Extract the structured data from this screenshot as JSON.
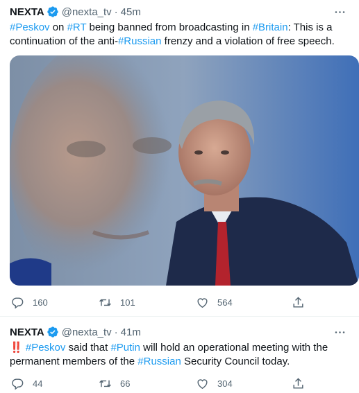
{
  "tweets": [
    {
      "name": "NEXTA",
      "handle": "@nexta_tv",
      "dot": "·",
      "time": "45m",
      "segments": [
        {
          "text": "#Peskov",
          "tag": true
        },
        {
          "text": " on ",
          "tag": false
        },
        {
          "text": "#RT",
          "tag": true
        },
        {
          "text": " being banned from broadcasting in ",
          "tag": false
        },
        {
          "text": "#Britain",
          "tag": true
        },
        {
          "text": ": This is a continuation of the anti-",
          "tag": false
        },
        {
          "text": "#Russian",
          "tag": true
        },
        {
          "text": " frenzy and a violation of free speech.",
          "tag": false
        }
      ],
      "replies": "160",
      "retweets": "101",
      "likes": "564"
    },
    {
      "name": "NEXTA",
      "handle": "@nexta_tv",
      "dot": "·",
      "time": "41m",
      "prefix_emoji": "‼️",
      "segments": [
        {
          "text": "#Peskov",
          "tag": true
        },
        {
          "text": " said that ",
          "tag": false
        },
        {
          "text": "#Putin",
          "tag": true
        },
        {
          "text": " will hold an operational meeting with the permanent members of the ",
          "tag": false
        },
        {
          "text": "#Russian",
          "tag": true
        },
        {
          "text": " Security Council today.",
          "tag": false
        }
      ],
      "replies": "44",
      "retweets": "66",
      "likes": "304"
    }
  ],
  "colors": {
    "accent": "#1d9bf0",
    "secondary_text": "#536471",
    "text": "#0f1419"
  },
  "icons": [
    "verified-badge-icon",
    "more-icon",
    "reply-icon",
    "retweet-icon",
    "like-icon",
    "share-icon"
  ]
}
